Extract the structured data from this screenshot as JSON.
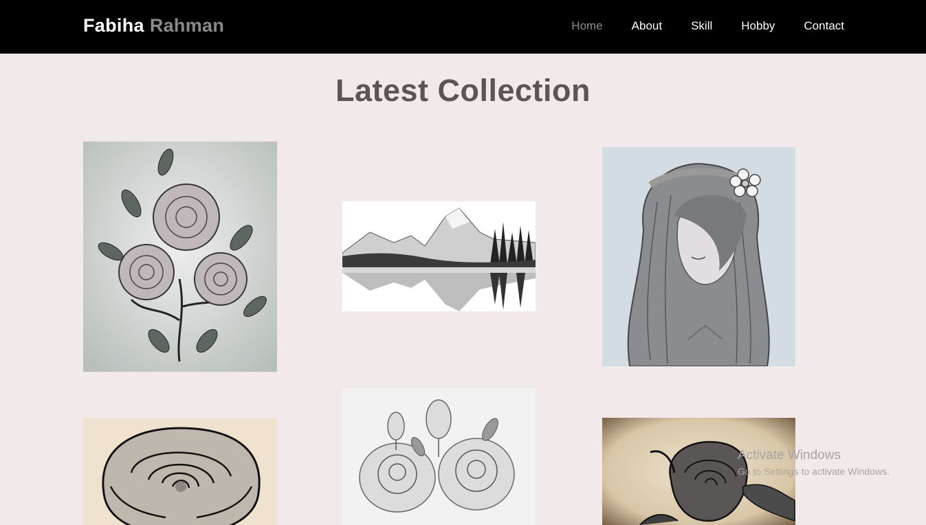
{
  "brand": {
    "first": "Fabiha",
    "last": "Rahman"
  },
  "nav": {
    "items": [
      {
        "label": "Home",
        "active": true
      },
      {
        "label": "About"
      },
      {
        "label": "Skill"
      },
      {
        "label": "Hobby"
      },
      {
        "label": "Contact"
      }
    ]
  },
  "section": {
    "title": "Latest Collection"
  },
  "gallery": [
    {
      "subject": "rose bouquet pencil sketch"
    },
    {
      "subject": "mountain lake pencil landscape"
    },
    {
      "subject": "girl with flower crown sketch"
    },
    {
      "subject": "sepia rose illustration"
    },
    {
      "subject": "roses pencil drawing"
    },
    {
      "subject": "rose with leaf on parchment"
    }
  ],
  "watermark": {
    "title": "Activate Windows",
    "subtitle": "Go to Settings to activate Windows."
  },
  "colors": {
    "header_bg": "#000000",
    "page_bg": "#f1e9ea",
    "title": "#5b5656",
    "nav_active": "#8b8b8b",
    "progress_accent": "#2f7fd9"
  }
}
